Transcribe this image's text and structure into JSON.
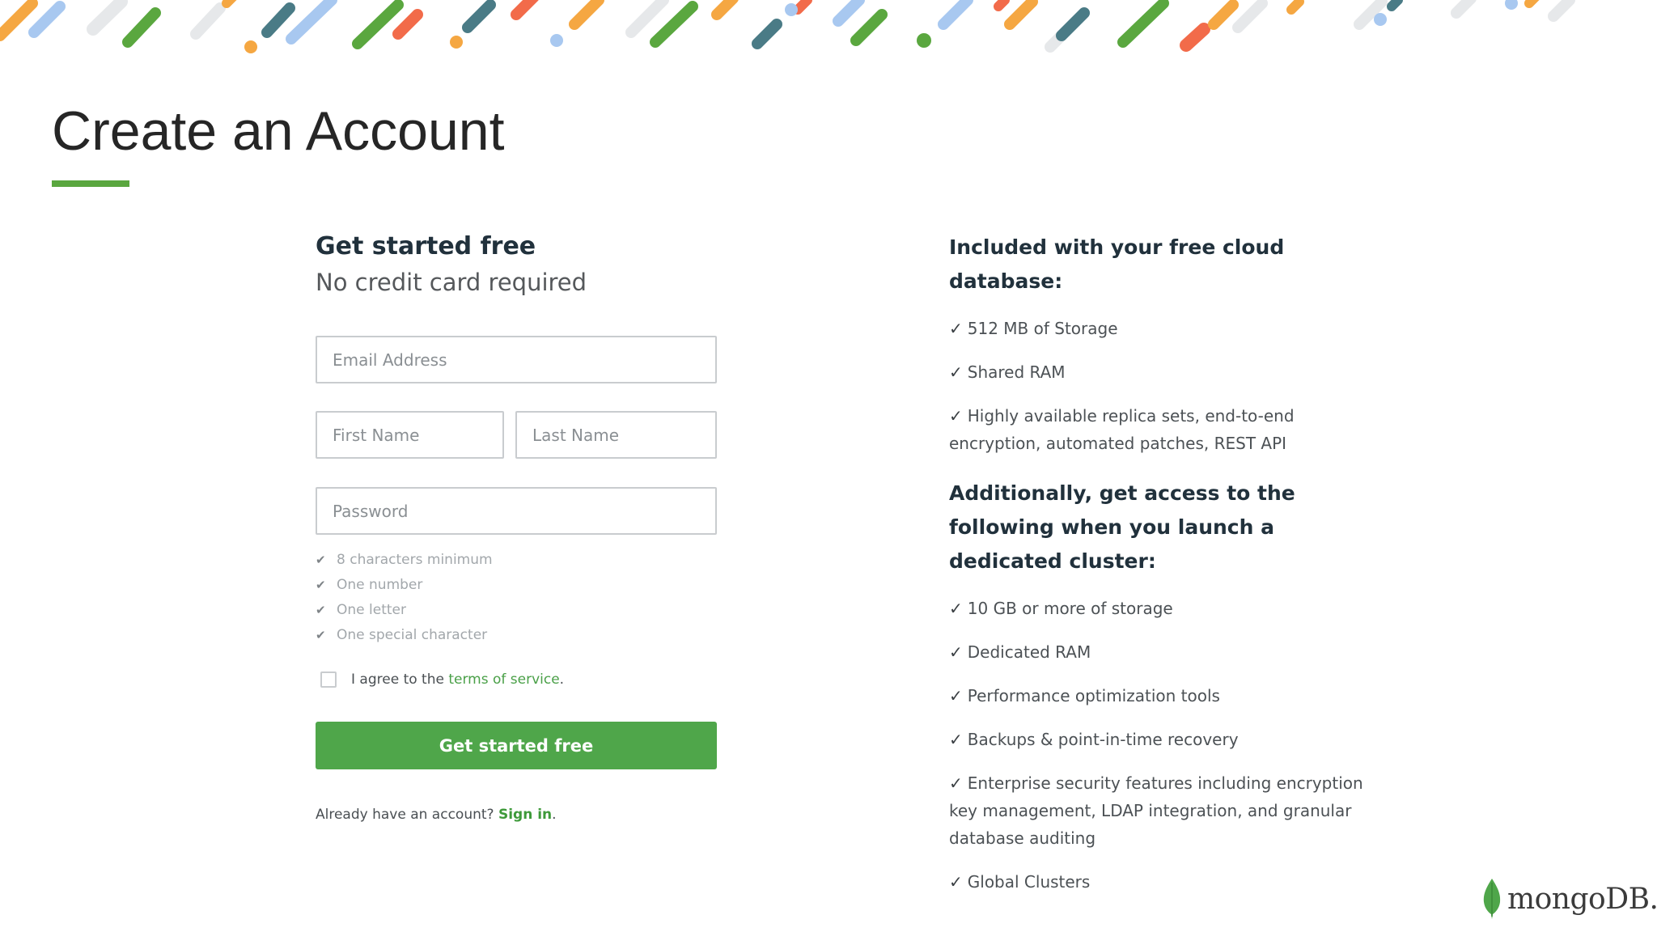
{
  "slide": {
    "title": "Create an Account",
    "accent_color": "#5aa73f"
  },
  "form": {
    "heading": "Get started free",
    "subheading": "No credit card required",
    "email_placeholder": "Email Address",
    "first_name_placeholder": "First Name",
    "last_name_placeholder": "Last Name",
    "password_placeholder": "Password",
    "password_requirements": [
      "8 characters minimum",
      "One number",
      "One letter",
      "One special character"
    ],
    "agree_prefix": "I agree to the ",
    "terms_link": "terms of service",
    "agree_suffix": ".",
    "submit_label": "Get started free",
    "already_prefix": "Already have an account? ",
    "sign_in_link": "Sign in",
    "already_suffix": ".",
    "button_color": "#4fa64a"
  },
  "info": {
    "heading_free": "Included with your free cloud database:",
    "free_features": [
      "512 MB of Storage",
      "Shared RAM",
      "Highly available replica sets, end-to-end encryption, automated patches, REST API"
    ],
    "heading_dedicated": "Additionally, get access to the following when you launch a dedicated cluster:",
    "dedicated_features": [
      "10 GB or more of storage",
      "Dedicated RAM",
      "Performance optimization tools",
      "Backups & point-in-time recovery",
      "Enterprise security features including encryption key management, LDAP integration, and granular database auditing",
      "Global Clusters"
    ],
    "tick_glyph": "✓"
  },
  "logo": {
    "text": "mongoDB.",
    "icon": "leaf-icon",
    "leaf_color": "#4fa64a"
  },
  "banner": {
    "icon": "decorative-stripes",
    "colors": [
      "#f5a742",
      "#5aa73f",
      "#4a7b86",
      "#a8c8f0",
      "#f26b4a",
      "#e6e8ea"
    ]
  }
}
